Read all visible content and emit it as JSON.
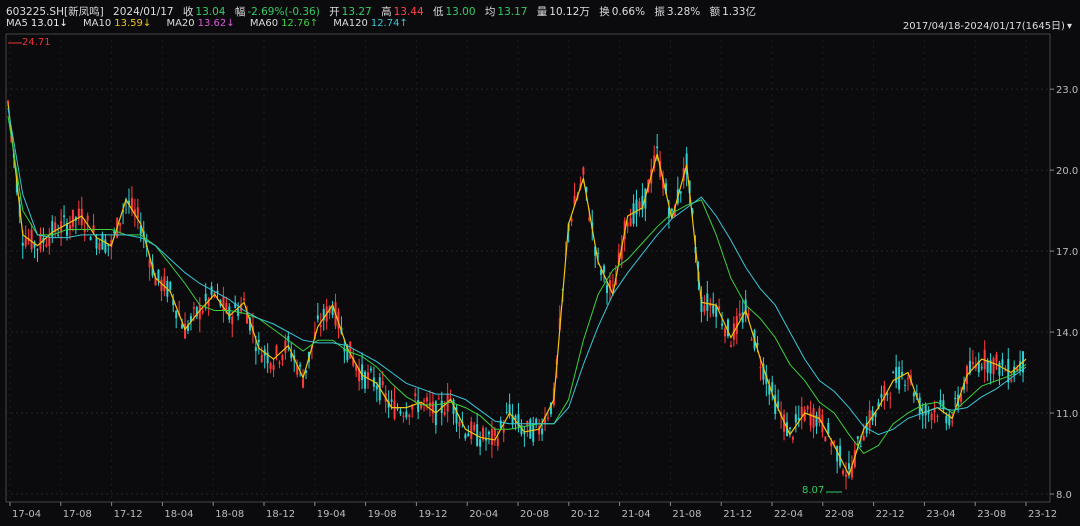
{
  "header": {
    "code": "603225.SH[新凤鸣]",
    "date": "2024/01/17",
    "close_label": "收",
    "close": "13.04",
    "change_label": "幅",
    "change": "-2.69%(-0.36)",
    "open_label": "开",
    "open": "13.27",
    "high_label": "高",
    "high": "13.44",
    "low_label": "低",
    "low": "13.00",
    "avg_label": "均",
    "avg": "13.17",
    "volume_label": "量",
    "volume": "10.12万",
    "turnover_label": "换",
    "turnover": "0.66%",
    "amplitude_label": "振",
    "amplitude": "3.28%",
    "amount_label": "额",
    "amount": "1.33亿",
    "range": "2017/04/18-2024/01/17(1645日)"
  },
  "ma": [
    {
      "name": "MA5",
      "value": "13.01↓",
      "color": "#f2f2f2"
    },
    {
      "name": "MA10",
      "value": "13.59↓",
      "color": "#f1c40f"
    },
    {
      "name": "MA20",
      "value": "13.62↓",
      "color": "#d65ad6"
    },
    {
      "name": "MA60",
      "value": "12.76↑",
      "color": "#3cd03c"
    },
    {
      "name": "MA120",
      "value": "12.74↑",
      "color": "#39c6d6"
    }
  ],
  "colors": {
    "up": "#ff3b3b",
    "down": "#2fd3d3",
    "grid": "#2a2a2a",
    "axis": "#bbbbbb"
  },
  "markers": {
    "high": "24.71",
    "low": "8.07"
  },
  "chart_data": {
    "type": "line",
    "ylim": [
      8.0,
      24.71
    ],
    "y_ticks": [
      8.0,
      11.0,
      14.0,
      17.0,
      20.0,
      23.0
    ],
    "y_tick_labels": [
      "8.0",
      "11.0",
      "14.0",
      "17.0",
      "20.0",
      "23.0"
    ],
    "x_tick_labels": [
      "17-04",
      "17-08",
      "17-12",
      "18-04",
      "18-08",
      "18-12",
      "19-04",
      "19-08",
      "19-12",
      "20-04",
      "20-08",
      "20-12",
      "21-04",
      "21-08",
      "21-12",
      "22-04",
      "22-08",
      "22-12",
      "23-04",
      "23-08",
      "23-12"
    ],
    "series": [
      {
        "name": "MA5",
        "values": [
          22.5,
          17.6,
          17.2,
          17.7,
          18.0,
          18.3,
          17.5,
          17.2,
          18.9,
          18.0,
          16.0,
          15.5,
          14.1,
          14.8,
          15.4,
          14.6,
          15.1,
          13.4,
          13.0,
          13.5,
          12.3,
          14.2,
          15.0,
          13.4,
          12.4,
          12.1,
          11.2,
          11.2,
          11.4,
          11.0,
          11.5,
          10.4,
          10.1,
          10.0,
          11.0,
          10.3,
          10.4,
          11.5,
          18.0,
          19.7,
          16.6,
          15.4,
          18.3,
          18.6,
          20.6,
          18.2,
          20.2,
          15.1,
          15.0,
          13.8,
          14.8,
          13.0,
          11.4,
          10.2,
          11.0,
          10.8,
          9.8,
          8.7,
          10.4,
          11.2,
          12.2,
          12.5,
          11.0,
          11.2,
          10.8,
          12.4,
          13.0,
          12.8,
          12.5,
          13.0
        ]
      },
      {
        "name": "MA60",
        "values": [
          22.0,
          18.5,
          17.6,
          17.6,
          17.8,
          17.8,
          17.8,
          17.8,
          17.6,
          17.6,
          17.2,
          16.5,
          15.8,
          15.0,
          14.8,
          14.8,
          14.7,
          14.5,
          14.1,
          13.7,
          13.3,
          13.7,
          13.7,
          13.3,
          13.1,
          12.7,
          12.1,
          11.6,
          11.3,
          11.3,
          11.4,
          11.2,
          10.9,
          10.4,
          10.4,
          10.5,
          10.6,
          10.6,
          11.5,
          13.7,
          15.4,
          16.3,
          16.7,
          17.3,
          17.9,
          18.4,
          18.7,
          18.9,
          17.6,
          16.0,
          15.0,
          14.5,
          13.8,
          12.8,
          12.2,
          11.4,
          11.0,
          10.2,
          9.5,
          9.8,
          10.6,
          11.0,
          11.3,
          11.4,
          11.0,
          11.5,
          12.0,
          12.2,
          12.4,
          12.8
        ]
      },
      {
        "name": "MA120",
        "values": [
          22.3,
          19.1,
          17.6,
          17.5,
          17.5,
          17.6,
          17.6,
          17.6,
          17.6,
          17.5,
          17.2,
          16.7,
          16.2,
          15.8,
          15.5,
          15.2,
          14.8,
          14.5,
          14.3,
          14.0,
          13.7,
          13.6,
          13.6,
          13.5,
          13.2,
          12.9,
          12.5,
          12.1,
          11.9,
          11.7,
          11.7,
          11.5,
          11.1,
          10.7,
          10.6,
          10.6,
          10.6,
          10.6,
          11.2,
          12.8,
          14.2,
          15.4,
          16.2,
          16.9,
          17.6,
          18.2,
          18.6,
          19.0,
          18.3,
          17.4,
          16.4,
          15.6,
          15.0,
          14.0,
          13.0,
          12.2,
          11.8,
          11.2,
          10.5,
          10.2,
          10.4,
          10.8,
          11.0,
          11.2,
          11.1,
          11.2,
          11.6,
          11.9,
          12.3,
          12.7
        ]
      }
    ]
  }
}
